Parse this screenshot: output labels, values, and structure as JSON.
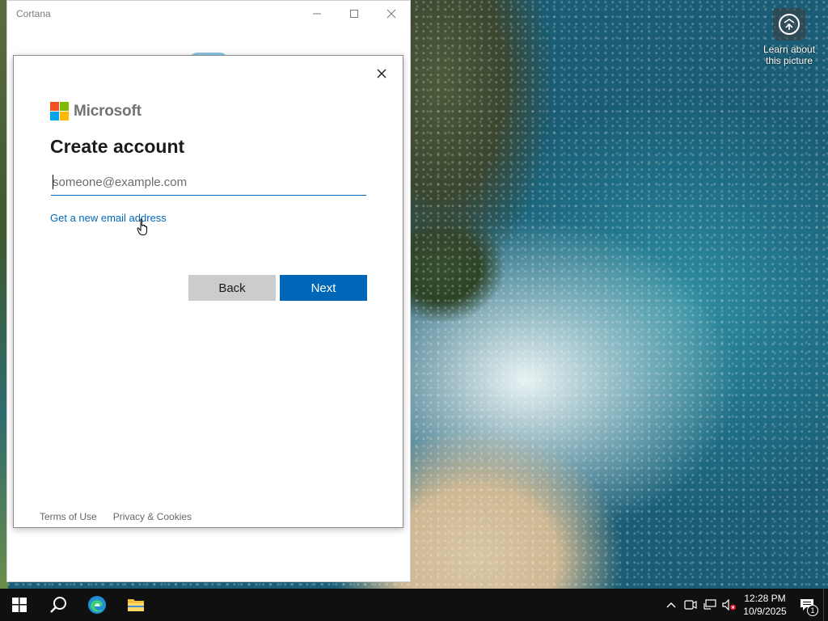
{
  "desktop": {
    "learn_about": "Learn about this picture"
  },
  "cortana_window": {
    "title": "Cortana"
  },
  "dialog": {
    "brand": "Microsoft",
    "heading": "Create account",
    "email_placeholder": "someone@example.com",
    "email_value": "",
    "new_email_link": "Get a new email address",
    "back_label": "Back",
    "next_label": "Next",
    "footer": {
      "terms": "Terms of Use",
      "privacy": "Privacy & Cookies"
    },
    "logo_colors": [
      "#f25022",
      "#7fba00",
      "#00a4ef",
      "#ffb900"
    ],
    "accent": "#0067b8"
  },
  "taskbar": {
    "pinned": [
      "start-icon",
      "search-icon",
      "edge-icon",
      "file-explorer-icon"
    ],
    "tray_icons": [
      "chevron-up-icon",
      "meet-now-icon",
      "network-icon",
      "volume-muted-icon"
    ],
    "time": "12:28 PM",
    "date": "10/9/2025",
    "notification_count": "1"
  }
}
